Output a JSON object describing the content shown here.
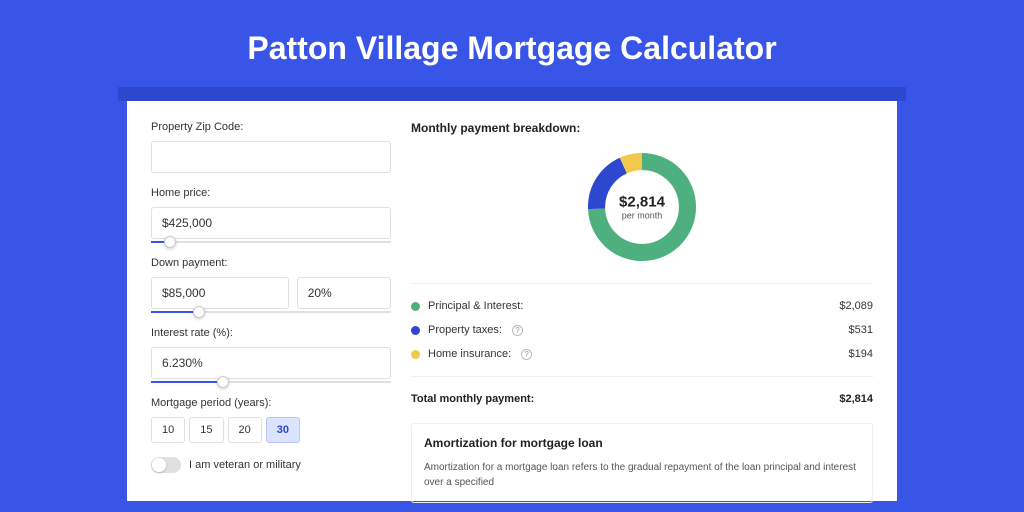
{
  "hero": {
    "title": "Patton Village Mortgage Calculator"
  },
  "form": {
    "zip": {
      "label": "Property Zip Code:",
      "value": ""
    },
    "price": {
      "label": "Home price:",
      "value": "$425,000",
      "slider_pct": 8
    },
    "down": {
      "label": "Down payment:",
      "value": "$85,000",
      "pct": "20%",
      "slider_pct": 20
    },
    "rate": {
      "label": "Interest rate (%):",
      "value": "6.230%",
      "slider_pct": 30
    },
    "period": {
      "label": "Mortgage period (years):",
      "options": [
        "10",
        "15",
        "20",
        "30"
      ],
      "selected": "30"
    },
    "veteran": {
      "label": "I am veteran or military",
      "on": false
    }
  },
  "breakdown": {
    "title": "Monthly payment breakdown:",
    "total_value": "$2,814",
    "total_sub": "per month",
    "rows": [
      {
        "label": "Principal & Interest:",
        "value": "$2,089",
        "color": "#4fb07f",
        "info": false
      },
      {
        "label": "Property taxes:",
        "value": "$531",
        "color": "#2d47cf",
        "info": true
      },
      {
        "label": "Home insurance:",
        "value": "$194",
        "color": "#f2c94c",
        "info": true
      }
    ],
    "total_row": {
      "label": "Total monthly payment:",
      "value": "$2,814"
    }
  },
  "chart_data": {
    "type": "pie",
    "title": "Monthly payment breakdown",
    "series": [
      {
        "name": "Principal & Interest",
        "value": 2089,
        "color": "#4fb07f"
      },
      {
        "name": "Property taxes",
        "value": 531,
        "color": "#2d47cf"
      },
      {
        "name": "Home insurance",
        "value": 194,
        "color": "#f2c94c"
      }
    ],
    "center_label": "$2,814",
    "center_sub": "per month"
  },
  "amortization": {
    "title": "Amortization for mortgage loan",
    "text": "Amortization for a mortgage loan refers to the gradual repayment of the loan principal and interest over a specified"
  }
}
